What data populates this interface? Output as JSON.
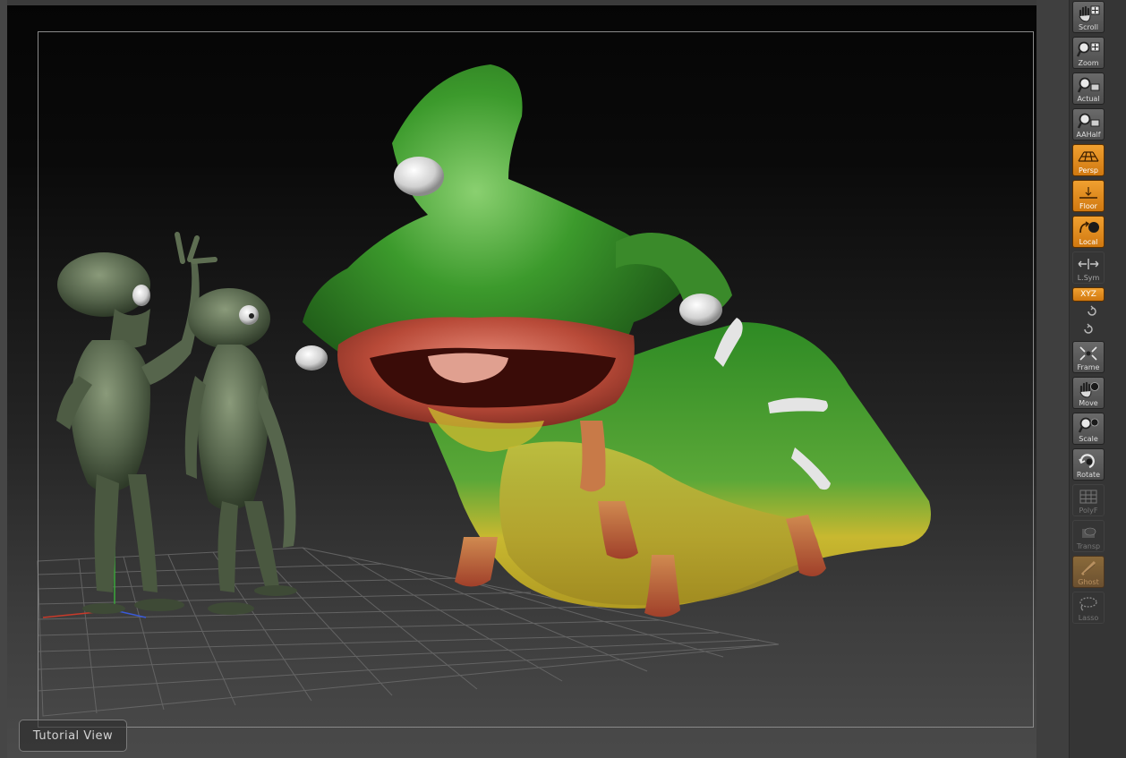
{
  "viewport": {
    "tutorial_label": "Tutorial View"
  },
  "tools": {
    "scroll": "Scroll",
    "zoom": "Zoom",
    "actual": "Actual",
    "aahalf": "AAHalf",
    "persp": "Persp",
    "floor": "Floor",
    "local": "Local",
    "lsym": "L.Sym",
    "xyz": "XYZ",
    "frame": "Frame",
    "move": "Move",
    "scale": "Scale",
    "rotate": "Rotate",
    "polyf": "PolyF",
    "transp": "Transp",
    "ghost": "Ghost",
    "lasso": "Lasso"
  },
  "colors": {
    "accent": "#e8901e",
    "creature_green": "#3a9a2a",
    "creature_yellow": "#c8b830",
    "alien_skin": "#5a6a50"
  }
}
